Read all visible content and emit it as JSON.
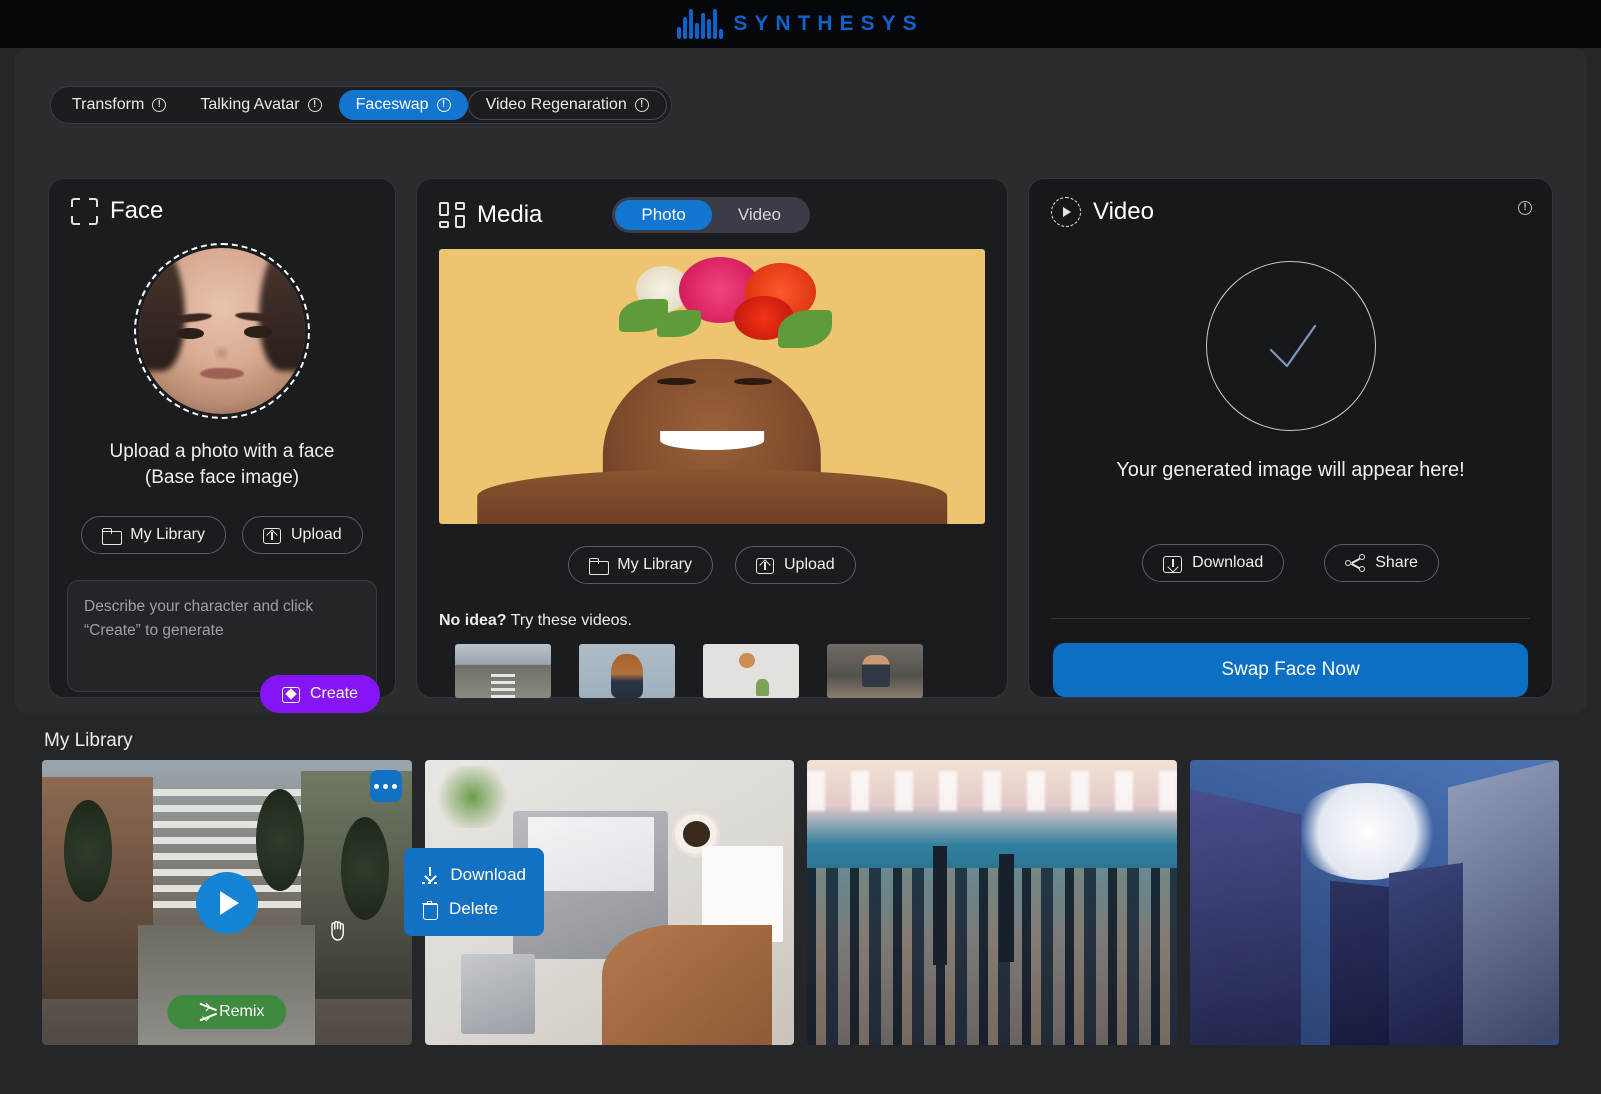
{
  "brand": {
    "name": "SYNTHESYS",
    "logo_icon": "waveform-icon",
    "color": "#0f62c8"
  },
  "tabs": [
    {
      "label": "Transform",
      "active": false,
      "info_icon": "info-icon"
    },
    {
      "label": "Talking Avatar",
      "active": false,
      "info_icon": "info-icon"
    },
    {
      "label": "Faceswap",
      "active": true,
      "info_icon": "info-icon"
    },
    {
      "label": "Video Regenaration",
      "active": false,
      "info_icon": "info-icon"
    }
  ],
  "face_panel": {
    "title": "Face",
    "icon": "face-scan-icon",
    "avatar_alt": "woman-face-photo",
    "hint_line1": "Upload a photo with a face",
    "hint_line2": "(Base face image)",
    "my_library_label": "My Library",
    "upload_label": "Upload",
    "prompt_placeholder": "Describe your character and click “Create” to generate",
    "create_label": "Create",
    "create_color": "#8615f5"
  },
  "media_panel": {
    "title": "Media",
    "icon": "media-grid-icon",
    "toggle": {
      "options": [
        "Photo",
        "Video"
      ],
      "selected": "Photo",
      "active_color": "#1275cf"
    },
    "preview_alt": "woman-with-flower-crown-on-yellow-background",
    "my_library_label": "My Library",
    "upload_label": "Upload",
    "try_prefix": "No idea?",
    "try_suffix": "Try these videos.",
    "sample_thumbs": [
      {
        "name": "street-scene-thumbnail"
      },
      {
        "name": "woman-portrait-thumbnail"
      },
      {
        "name": "wall-clock-plant-thumbnail"
      },
      {
        "name": "man-at-desk-thumbnail"
      }
    ]
  },
  "video_panel": {
    "title": "Video",
    "icon": "play-circle-icon",
    "info_icon": "info-icon",
    "status_icon": "checkmark-circle-icon",
    "message": "Your generated image will appear here!",
    "download_label": "Download",
    "share_label": "Share",
    "primary_action": "Swap Face Now",
    "primary_color": "#0b6fc4"
  },
  "library": {
    "title": "My Library",
    "items": [
      {
        "name": "street-video-card",
        "alt": "city-street-video",
        "has_play": true,
        "remix_label": "Remix",
        "remix_color": "#3f8a3f",
        "menu_open": true
      },
      {
        "name": "desk-laptop-card",
        "alt": "desk-with-laptop-and-coffee",
        "has_play": false
      },
      {
        "name": "city-skyline-card",
        "alt": "city-skyline-at-dusk",
        "has_play": false
      },
      {
        "name": "glass-towers-card",
        "alt": "glass-skyscrapers-looking-up",
        "has_play": false
      }
    ],
    "context_menu": {
      "color": "#1271c3",
      "items": [
        {
          "label": "Download",
          "icon": "download-icon"
        },
        {
          "label": "Delete",
          "icon": "trash-icon"
        }
      ]
    }
  }
}
